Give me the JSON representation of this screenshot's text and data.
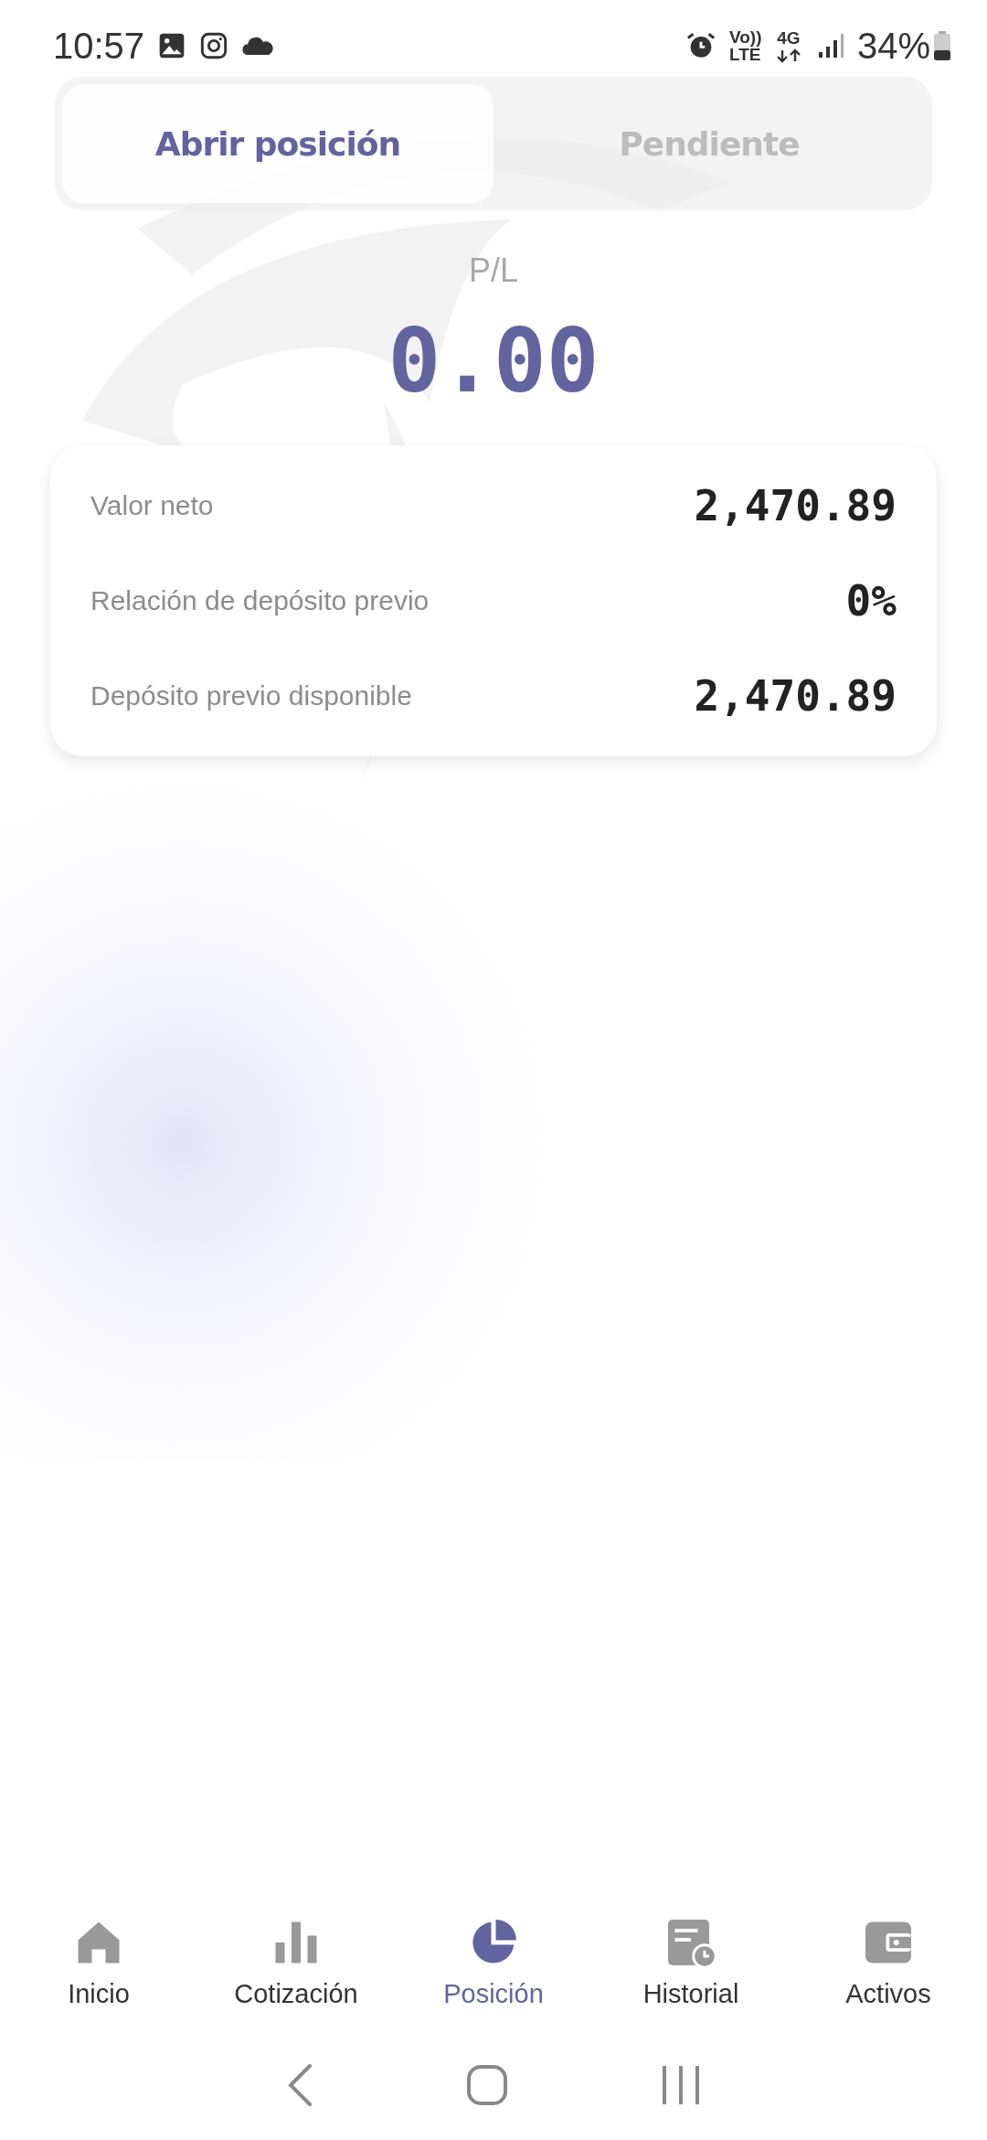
{
  "status_bar": {
    "time": "10:57",
    "network_type": "4G",
    "volte": "Vo)) LTE",
    "battery": "34%"
  },
  "tabs": [
    {
      "label": "Abrir posición",
      "selected": true
    },
    {
      "label": "Pendiente",
      "selected": false
    }
  ],
  "pl": {
    "label": "P/L",
    "value": "0.00"
  },
  "summary": [
    {
      "label": "Valor neto",
      "value": "2,470.89"
    },
    {
      "label": "Relación de depósito previo",
      "value": "0%"
    },
    {
      "label": "Depósito previo disponible",
      "value": "2,470.89"
    }
  ],
  "bottom_nav": [
    {
      "label": "Inicio",
      "kind": "home",
      "selected": false
    },
    {
      "label": "Cotización",
      "kind": "chart",
      "selected": false
    },
    {
      "label": "Posición",
      "kind": "pie",
      "selected": true
    },
    {
      "label": "Historial",
      "kind": "history",
      "selected": false
    },
    {
      "label": "Activos",
      "kind": "wallet",
      "selected": false
    }
  ]
}
